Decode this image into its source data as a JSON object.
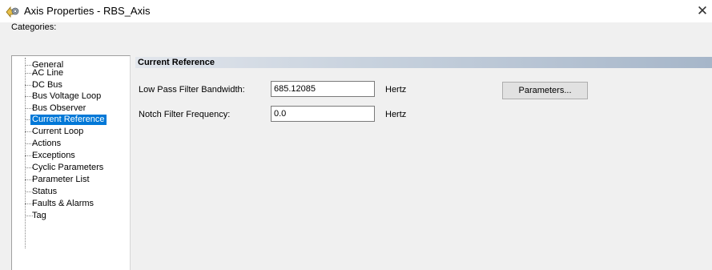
{
  "window": {
    "title": "Axis Properties - RBS_Axis",
    "close_glyph": "✕",
    "icon": "axis-properties-icon"
  },
  "categories": {
    "label": "Categories:",
    "items": [
      {
        "label": "General"
      },
      {
        "label": "AC Line"
      },
      {
        "label": "DC Bus"
      },
      {
        "label": "Bus Voltage Loop"
      },
      {
        "label": "Bus Observer"
      },
      {
        "label": "Current Reference",
        "selected": true
      },
      {
        "label": "Current Loop"
      },
      {
        "label": "Actions"
      },
      {
        "label": "Exceptions"
      },
      {
        "label": "Cyclic Parameters"
      },
      {
        "label": "Parameter List"
      },
      {
        "label": "Status"
      },
      {
        "label": "Faults & Alarms"
      },
      {
        "label": "Tag"
      }
    ]
  },
  "panel": {
    "header": "Current Reference",
    "low_pass": {
      "label": "Low Pass Filter Bandwidth:",
      "value": "685.12085",
      "unit": "Hertz"
    },
    "notch": {
      "label": "Notch Filter Frequency:",
      "value": "0.0",
      "unit": "Hertz"
    },
    "parameters_button": "Parameters..."
  },
  "colors": {
    "selection": "#0078d7",
    "header_gradient_end": "#a6b6c9",
    "dialog_bg": "#f0f0f0"
  }
}
